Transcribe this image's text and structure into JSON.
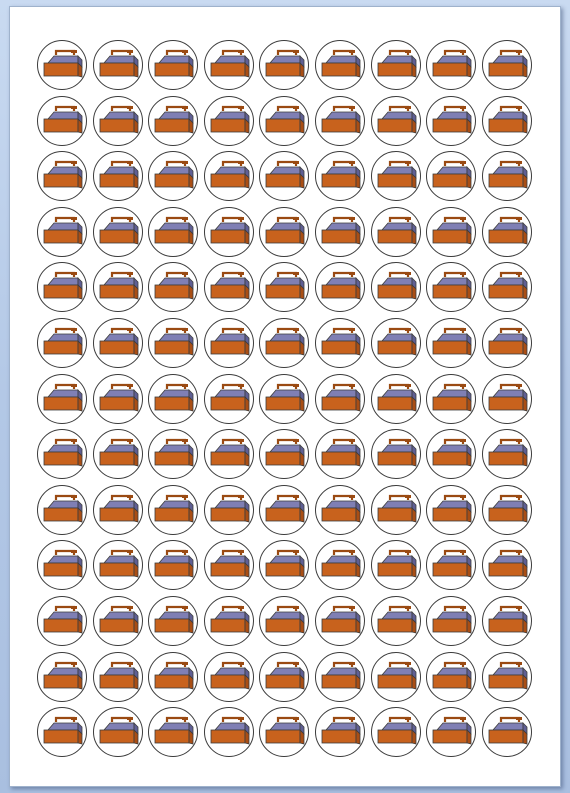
{
  "sheet": {
    "rows": 13,
    "columns": 9,
    "sticker_icon": "toolbox-icon",
    "colors": {
      "box_front": "#c8621d",
      "box_shade": "#a94e14",
      "lid": "#7f7fb4",
      "lid_dark": "#5f5f94",
      "handle": "#9a4a12",
      "outline": "#3c3c3c"
    }
  }
}
